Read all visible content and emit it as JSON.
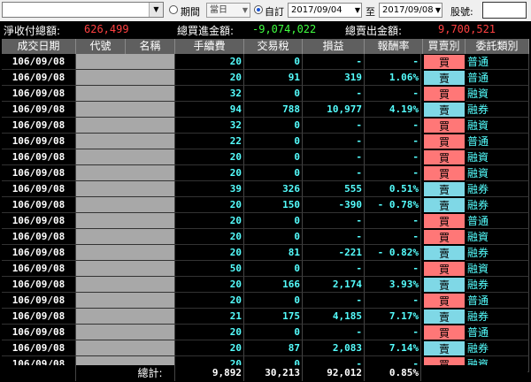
{
  "toolbar": {
    "period_label": "期間",
    "period_value": "當日",
    "custom_label": "自訂",
    "from_date": "2017/09/04",
    "to_label": "至",
    "to_date": "2017/09/08",
    "stock_label": "股號:",
    "stock_input": "",
    "dropdown_arrow": "▼"
  },
  "summary": {
    "net_label": "淨收付總額:",
    "net_value": "626,499",
    "buy_label": "總買進金額:",
    "buy_value": "-9,074,022",
    "sell_label": "總賣出金額:",
    "sell_value": "9,700,521"
  },
  "columns": [
    "成交日期",
    "代號",
    "名稱",
    "手續費",
    "交易稅",
    "損益",
    "報酬率",
    "買賣別",
    "委託類別"
  ],
  "rows": [
    {
      "date": "106/09/08",
      "fee": "20",
      "tax": "0",
      "pl": "-",
      "ret": "-",
      "side": "買",
      "type": "普通"
    },
    {
      "date": "106/09/08",
      "fee": "20",
      "tax": "91",
      "pl": "319",
      "ret": "1.06%",
      "side": "賣",
      "type": "普通"
    },
    {
      "date": "106/09/08",
      "fee": "32",
      "tax": "0",
      "pl": "-",
      "ret": "-",
      "side": "買",
      "type": "融資"
    },
    {
      "date": "106/09/08",
      "fee": "94",
      "tax": "788",
      "pl": "10,977",
      "ret": "4.19%",
      "side": "賣",
      "type": "融券"
    },
    {
      "date": "106/09/08",
      "fee": "32",
      "tax": "0",
      "pl": "-",
      "ret": "-",
      "side": "買",
      "type": "融資"
    },
    {
      "date": "106/09/08",
      "fee": "22",
      "tax": "0",
      "pl": "-",
      "ret": "-",
      "side": "買",
      "type": "普通"
    },
    {
      "date": "106/09/08",
      "fee": "20",
      "tax": "0",
      "pl": "-",
      "ret": "-",
      "side": "買",
      "type": "融資"
    },
    {
      "date": "106/09/08",
      "fee": "20",
      "tax": "0",
      "pl": "-",
      "ret": "-",
      "side": "買",
      "type": "融資"
    },
    {
      "date": "106/09/08",
      "fee": "39",
      "tax": "326",
      "pl": "555",
      "ret": "0.51%",
      "side": "賣",
      "type": "融券"
    },
    {
      "date": "106/09/08",
      "fee": "20",
      "tax": "150",
      "pl": "-390",
      "ret": "- 0.78%",
      "side": "賣",
      "type": "融券"
    },
    {
      "date": "106/09/08",
      "fee": "20",
      "tax": "0",
      "pl": "-",
      "ret": "-",
      "side": "買",
      "type": "普通"
    },
    {
      "date": "106/09/08",
      "fee": "20",
      "tax": "0",
      "pl": "-",
      "ret": "-",
      "side": "買",
      "type": "融資"
    },
    {
      "date": "106/09/08",
      "fee": "20",
      "tax": "81",
      "pl": "-221",
      "ret": "- 0.82%",
      "side": "賣",
      "type": "融券"
    },
    {
      "date": "106/09/08",
      "fee": "50",
      "tax": "0",
      "pl": "-",
      "ret": "-",
      "side": "買",
      "type": "融資"
    },
    {
      "date": "106/09/08",
      "fee": "20",
      "tax": "166",
      "pl": "2,174",
      "ret": "3.93%",
      "side": "賣",
      "type": "融券"
    },
    {
      "date": "106/09/08",
      "fee": "20",
      "tax": "0",
      "pl": "-",
      "ret": "-",
      "side": "買",
      "type": "普通"
    },
    {
      "date": "106/09/08",
      "fee": "21",
      "tax": "175",
      "pl": "4,185",
      "ret": "7.17%",
      "side": "賣",
      "type": "融券"
    },
    {
      "date": "106/09/08",
      "fee": "20",
      "tax": "0",
      "pl": "-",
      "ret": "-",
      "side": "買",
      "type": "普通"
    },
    {
      "date": "106/09/08",
      "fee": "20",
      "tax": "87",
      "pl": "2,083",
      "ret": "7.14%",
      "side": "賣",
      "type": "融券"
    },
    {
      "date": "106/09/08",
      "fee": "20",
      "tax": "0",
      "pl": "-",
      "ret": "-",
      "side": "買",
      "type": "融資"
    }
  ],
  "total": {
    "label": "總計:",
    "fee": "9,892",
    "tax": "30,213",
    "pl": "92,012",
    "ret": "0.85%"
  },
  "colors": {
    "buy": "#ff7777",
    "sell": "#7fd8e6",
    "value_text": "#55ffff",
    "summary_red": "#ff4040",
    "summary_green": "#40ff40"
  }
}
